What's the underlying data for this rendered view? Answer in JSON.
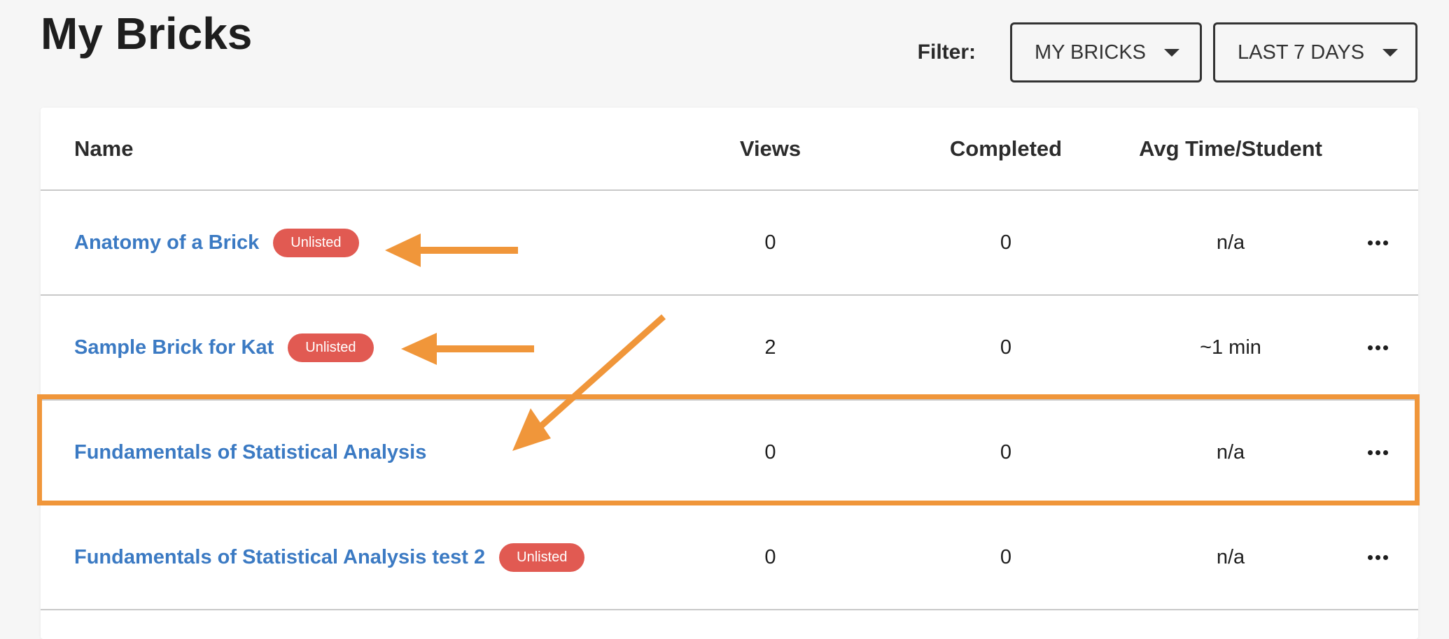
{
  "page": {
    "title": "My Bricks"
  },
  "filter": {
    "label": "Filter:",
    "dropdowns": [
      {
        "value": "MY BRICKS"
      },
      {
        "value": "LAST 7 DAYS"
      }
    ]
  },
  "table": {
    "columns": [
      "Name",
      "Views",
      "Completed",
      "Avg Time/Student"
    ],
    "rows": [
      {
        "name": "Anatomy of a Brick",
        "badge": "Unlisted",
        "views": "0",
        "completed": "0",
        "avg_time": "n/a"
      },
      {
        "name": "Sample Brick for Kat",
        "badge": "Unlisted",
        "views": "2",
        "completed": "0",
        "avg_time": "~1 min"
      },
      {
        "name": "Fundamentals of Statistical Analysis",
        "badge": "",
        "views": "0",
        "completed": "0",
        "avg_time": "n/a"
      },
      {
        "name": "Fundamentals of Statistical Analysis test 2",
        "badge": "Unlisted",
        "views": "0",
        "completed": "0",
        "avg_time": "n/a"
      }
    ]
  },
  "annotation": {
    "color": "#f0963a",
    "highlighted_row": "Fundamentals of Statistical Analysis"
  },
  "colors": {
    "link": "#3b7ac3",
    "badge": "#e15a52",
    "background": "#f6f6f6"
  }
}
